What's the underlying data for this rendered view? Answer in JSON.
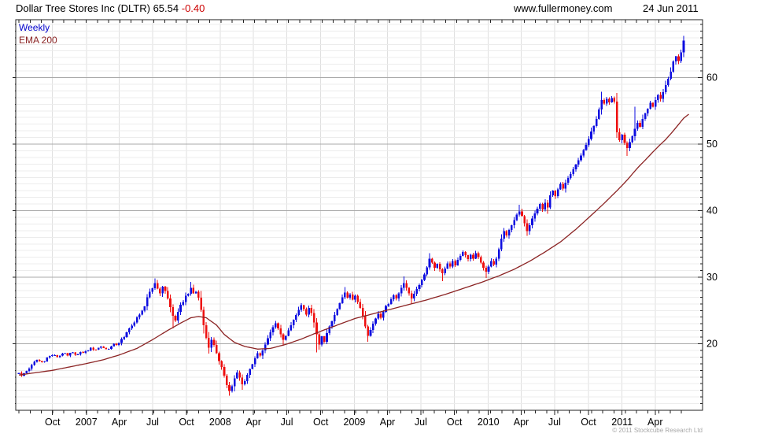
{
  "header": {
    "title_main": "Dollar Tree Stores Inc (DLTR) 65.54",
    "title_change": "-0.40",
    "site": "www.fullermoney.com",
    "date": "24 Jun 2011"
  },
  "legend": {
    "timeframe": "Weekly",
    "overlay": "EMA 200"
  },
  "footer": {
    "copyright": "© 2011 Stockcube Research Ltd"
  },
  "colors": {
    "up_candle": "#0d0de0",
    "down_candle": "#ee0f0f",
    "ema_line": "#8b2323",
    "legend_weekly": "#0000cc",
    "change_text": "#cc0000",
    "grid_minor": "#ececec",
    "grid_vertical": "#dfdfdf",
    "grid_major": "#a9a9a9",
    "axis": "#222222",
    "label_text": "#000000",
    "copyright_text": "#a8a8a8"
  },
  "chart_data": {
    "type": "candlestick",
    "title": "Dollar Tree Stores Inc (DLTR)",
    "ticker": "DLTR",
    "timeframe": "Weekly",
    "overlay": "EMA 200",
    "last_price": 65.54,
    "change": -0.4,
    "weeks_total": 260,
    "months_total": 60,
    "y_axis": {
      "min": 10.0,
      "max": 68.7,
      "major_ticks": [
        20,
        30,
        40,
        50,
        60
      ],
      "minor_step": 1
    },
    "x_axis": {
      "ticks": [
        {
          "label": "Oct",
          "week": 13.1
        },
        {
          "label": "2007",
          "week": 26.3
        },
        {
          "label": "Apr",
          "week": 39.1
        },
        {
          "label": "Jul",
          "week": 52.1
        },
        {
          "label": "Oct",
          "week": 65.3
        },
        {
          "label": "2008",
          "week": 78.4
        },
        {
          "label": "Apr",
          "week": 91.4
        },
        {
          "label": "Jul",
          "week": 104.4
        },
        {
          "label": "Oct",
          "week": 117.6
        },
        {
          "label": "2009",
          "week": 130.7
        },
        {
          "label": "Apr",
          "week": 143.6
        },
        {
          "label": "Jul",
          "week": 156.6
        },
        {
          "label": "Oct",
          "week": 169.7
        },
        {
          "label": "2010",
          "week": 182.9
        },
        {
          "label": "Apr",
          "week": 195.7
        },
        {
          "label": "Jul",
          "week": 208.7
        },
        {
          "label": "Oct",
          "week": 221.9
        },
        {
          "label": "2011",
          "week": 235.0
        },
        {
          "label": "Apr",
          "week": 247.9
        }
      ]
    },
    "close_anchors": [
      [
        0,
        15.6
      ],
      [
        1,
        15.2
      ],
      [
        3,
        15.9
      ],
      [
        5,
        16.8
      ],
      [
        7,
        17.6
      ],
      [
        9,
        17.2
      ],
      [
        11,
        17.9
      ],
      [
        13,
        18.3
      ],
      [
        15,
        18.0
      ],
      [
        17,
        18.5
      ],
      [
        19,
        18.2
      ],
      [
        21,
        18.7
      ],
      [
        23,
        18.4
      ],
      [
        26,
        18.9
      ],
      [
        28,
        19.4
      ],
      [
        30,
        19.1
      ],
      [
        32,
        19.6
      ],
      [
        34,
        19.2
      ],
      [
        36,
        19.6
      ],
      [
        39,
        20.1
      ],
      [
        41,
        21.0
      ],
      [
        43,
        22.3
      ],
      [
        45,
        23.2
      ],
      [
        47,
        24.4
      ],
      [
        49,
        25.6
      ],
      [
        51,
        27.8
      ],
      [
        53,
        29.1
      ],
      [
        54,
        28.3
      ],
      [
        55,
        27.6
      ],
      [
        56,
        28.6
      ],
      [
        57,
        27.9
      ],
      [
        58,
        26.8
      ],
      [
        59,
        25.5
      ],
      [
        60,
        24.2
      ],
      [
        61,
        23.5
      ],
      [
        62,
        24.8
      ],
      [
        64,
        26.3
      ],
      [
        65,
        27.2
      ],
      [
        67,
        28.4
      ],
      [
        68,
        27.6
      ],
      [
        69,
        27.8
      ],
      [
        70,
        26.9
      ],
      [
        71,
        25.1
      ],
      [
        72,
        22.8
      ],
      [
        73,
        20.9
      ],
      [
        74,
        19.4
      ],
      [
        75,
        20.6
      ],
      [
        76,
        19.8
      ],
      [
        77,
        18.6
      ],
      [
        78,
        17.4
      ],
      [
        79,
        16.5
      ],
      [
        80,
        15.2
      ],
      [
        81,
        13.8
      ],
      [
        82,
        12.9
      ],
      [
        83,
        13.6
      ],
      [
        84,
        14.8
      ],
      [
        85,
        15.7
      ],
      [
        86,
        14.9
      ],
      [
        87,
        13.9
      ],
      [
        88,
        14.4
      ],
      [
        89,
        15.3
      ],
      [
        90,
        16.2
      ],
      [
        91,
        16.9
      ],
      [
        92,
        17.8
      ],
      [
        93,
        18.6
      ],
      [
        94,
        18.2
      ],
      [
        95,
        19.0
      ],
      [
        96,
        19.9
      ],
      [
        97,
        20.8
      ],
      [
        98,
        21.7
      ],
      [
        99,
        22.5
      ],
      [
        100,
        23.1
      ],
      [
        101,
        22.3
      ],
      [
        102,
        21.4
      ],
      [
        103,
        20.6
      ],
      [
        104,
        21.2
      ],
      [
        105,
        22.0
      ],
      [
        106,
        22.8
      ],
      [
        107,
        23.6
      ],
      [
        108,
        24.3
      ],
      [
        109,
        25.1
      ],
      [
        110,
        25.8
      ],
      [
        111,
        25.2
      ],
      [
        112,
        24.4
      ],
      [
        113,
        25.4
      ],
      [
        114,
        24.6
      ],
      [
        115,
        23.2
      ],
      [
        116,
        21.4
      ],
      [
        117,
        19.9
      ],
      [
        118,
        21.1
      ],
      [
        119,
        20.3
      ],
      [
        120,
        21.6
      ],
      [
        121,
        22.6
      ],
      [
        122,
        23.4
      ],
      [
        123,
        24.3
      ],
      [
        124,
        25.2
      ],
      [
        125,
        26.1
      ],
      [
        126,
        27.0
      ],
      [
        127,
        27.7
      ],
      [
        128,
        26.9
      ],
      [
        129,
        27.4
      ],
      [
        130,
        26.6
      ],
      [
        131,
        27.2
      ],
      [
        132,
        26.3
      ],
      [
        133,
        25.4
      ],
      [
        134,
        24.2
      ],
      [
        135,
        22.6
      ],
      [
        136,
        21.2
      ],
      [
        137,
        22.1
      ],
      [
        138,
        23.0
      ],
      [
        139,
        23.8
      ],
      [
        140,
        24.5
      ],
      [
        141,
        23.9
      ],
      [
        142,
        24.8
      ],
      [
        144,
        26.0
      ],
      [
        145,
        26.7
      ],
      [
        146,
        27.3
      ],
      [
        147,
        26.8
      ],
      [
        148,
        27.6
      ],
      [
        149,
        28.4
      ],
      [
        150,
        29.1
      ],
      [
        151,
        28.4
      ],
      [
        152,
        27.6
      ],
      [
        153,
        26.8
      ],
      [
        154,
        27.5
      ],
      [
        155,
        28.2
      ],
      [
        156,
        28.8
      ],
      [
        157,
        29.6
      ],
      [
        158,
        30.4
      ],
      [
        159,
        31.5
      ],
      [
        160,
        32.8
      ],
      [
        161,
        32.2
      ],
      [
        162,
        31.4
      ],
      [
        163,
        32.0
      ],
      [
        164,
        31.2
      ],
      [
        165,
        30.6
      ],
      [
        166,
        31.3
      ],
      [
        167,
        32.1
      ],
      [
        168,
        31.6
      ],
      [
        169,
        32.4
      ],
      [
        170,
        31.8
      ],
      [
        171,
        32.6
      ],
      [
        172,
        33.2
      ],
      [
        173,
        33.8
      ],
      [
        174,
        33.3
      ],
      [
        175,
        32.7
      ],
      [
        176,
        33.4
      ],
      [
        177,
        32.8
      ],
      [
        178,
        33.6
      ],
      [
        179,
        33.0
      ],
      [
        180,
        32.2
      ],
      [
        181,
        31.4
      ],
      [
        182,
        30.8
      ],
      [
        183,
        31.6
      ],
      [
        184,
        32.4
      ],
      [
        185,
        31.9
      ],
      [
        186,
        32.8
      ],
      [
        187,
        34.2
      ],
      [
        188,
        35.8
      ],
      [
        189,
        36.9
      ],
      [
        190,
        36.3
      ],
      [
        191,
        37.1
      ],
      [
        192,
        37.8
      ],
      [
        193,
        38.6
      ],
      [
        194,
        39.4
      ],
      [
        195,
        39.9
      ],
      [
        196,
        39.2
      ],
      [
        197,
        38.1
      ],
      [
        198,
        36.9
      ],
      [
        199,
        37.8
      ],
      [
        200,
        38.8
      ],
      [
        201,
        39.6
      ],
      [
        202,
        40.3
      ],
      [
        203,
        41.0
      ],
      [
        204,
        40.2
      ],
      [
        205,
        41.2
      ],
      [
        206,
        40.5
      ],
      [
        207,
        42.3
      ],
      [
        208,
        43.0
      ],
      [
        209,
        42.2
      ],
      [
        210,
        43.2
      ],
      [
        211,
        44.0
      ],
      [
        212,
        43.3
      ],
      [
        213,
        44.2
      ],
      [
        214,
        44.9
      ],
      [
        215,
        45.5
      ],
      [
        216,
        46.2
      ],
      [
        217,
        46.9
      ],
      [
        218,
        47.6
      ],
      [
        219,
        48.3
      ],
      [
        220,
        49.1
      ],
      [
        221,
        49.9
      ],
      [
        222,
        50.8
      ],
      [
        223,
        51.9
      ],
      [
        224,
        52.7
      ],
      [
        225,
        53.8
      ],
      [
        226,
        55.2
      ],
      [
        227,
        56.6
      ],
      [
        228,
        56.1
      ],
      [
        229,
        56.8
      ],
      [
        230,
        56.3
      ],
      [
        231,
        56.9
      ],
      [
        232,
        56.4
      ],
      [
        233,
        51.8
      ],
      [
        234,
        50.6
      ],
      [
        235,
        51.4
      ],
      [
        236,
        50.2
      ],
      [
        237,
        49.4
      ],
      [
        238,
        50.3
      ],
      [
        239,
        51.2
      ],
      [
        240,
        52.3
      ],
      [
        241,
        53.2
      ],
      [
        242,
        52.6
      ],
      [
        243,
        53.8
      ],
      [
        244,
        54.6
      ],
      [
        245,
        55.3
      ],
      [
        246,
        56.2
      ],
      [
        247,
        55.6
      ],
      [
        248,
        56.6
      ],
      [
        249,
        57.4
      ],
      [
        250,
        56.8
      ],
      [
        251,
        57.8
      ],
      [
        252,
        58.9
      ],
      [
        253,
        59.8
      ],
      [
        254,
        60.9
      ],
      [
        255,
        62.4
      ],
      [
        256,
        63.2
      ],
      [
        257,
        62.5
      ],
      [
        258,
        63.8
      ],
      [
        259,
        65.54
      ]
    ],
    "ema_anchors": [
      [
        0,
        15.3
      ],
      [
        13,
        16.0
      ],
      [
        26,
        17.0
      ],
      [
        33,
        17.6
      ],
      [
        39,
        18.3
      ],
      [
        46,
        19.3
      ],
      [
        52,
        20.6
      ],
      [
        58,
        22.0
      ],
      [
        63,
        23.1
      ],
      [
        67,
        23.9
      ],
      [
        70,
        24.1
      ],
      [
        73,
        23.9
      ],
      [
        77,
        22.8
      ],
      [
        80,
        21.4
      ],
      [
        84,
        20.2
      ],
      [
        88,
        19.6
      ],
      [
        93,
        19.2
      ],
      [
        98,
        19.3
      ],
      [
        104,
        19.9
      ],
      [
        110,
        20.7
      ],
      [
        117,
        21.8
      ],
      [
        124,
        22.8
      ],
      [
        131,
        23.8
      ],
      [
        138,
        24.5
      ],
      [
        145,
        25.2
      ],
      [
        152,
        25.9
      ],
      [
        159,
        26.6
      ],
      [
        166,
        27.4
      ],
      [
        173,
        28.3
      ],
      [
        180,
        29.2
      ],
      [
        187,
        30.2
      ],
      [
        193,
        31.2
      ],
      [
        199,
        32.4
      ],
      [
        205,
        33.8
      ],
      [
        211,
        35.3
      ],
      [
        217,
        37.2
      ],
      [
        223,
        39.3
      ],
      [
        228,
        41.1
      ],
      [
        233,
        43.0
      ],
      [
        237,
        44.6
      ],
      [
        241,
        46.4
      ],
      [
        245,
        48.0
      ],
      [
        249,
        49.6
      ],
      [
        252,
        50.7
      ],
      [
        255,
        52.0
      ],
      [
        259,
        53.9
      ],
      [
        261,
        54.5
      ]
    ],
    "wick_overrides": [
      [
        53,
        "h",
        29.8
      ],
      [
        60,
        "l",
        22.3
      ],
      [
        67,
        "h",
        29.3
      ],
      [
        82,
        "l",
        12.2
      ],
      [
        87,
        "l",
        13.1
      ],
      [
        103,
        "l",
        19.7
      ],
      [
        116,
        "l",
        18.7
      ],
      [
        127,
        "h",
        28.5
      ],
      [
        136,
        "l",
        20.3
      ],
      [
        150,
        "h",
        30.1
      ],
      [
        153,
        "l",
        26.0
      ],
      [
        160,
        "h",
        33.6
      ],
      [
        165,
        "l",
        29.4
      ],
      [
        182,
        "l",
        29.9
      ],
      [
        195,
        "h",
        40.9
      ],
      [
        198,
        "l",
        36.2
      ],
      [
        206,
        "l",
        39.5
      ],
      [
        227,
        "h",
        57.9
      ],
      [
        237,
        "l",
        48.2
      ],
      [
        240,
        "h",
        55.6
      ],
      [
        255,
        "h",
        62.6
      ],
      [
        259,
        "h",
        66.3
      ]
    ]
  }
}
